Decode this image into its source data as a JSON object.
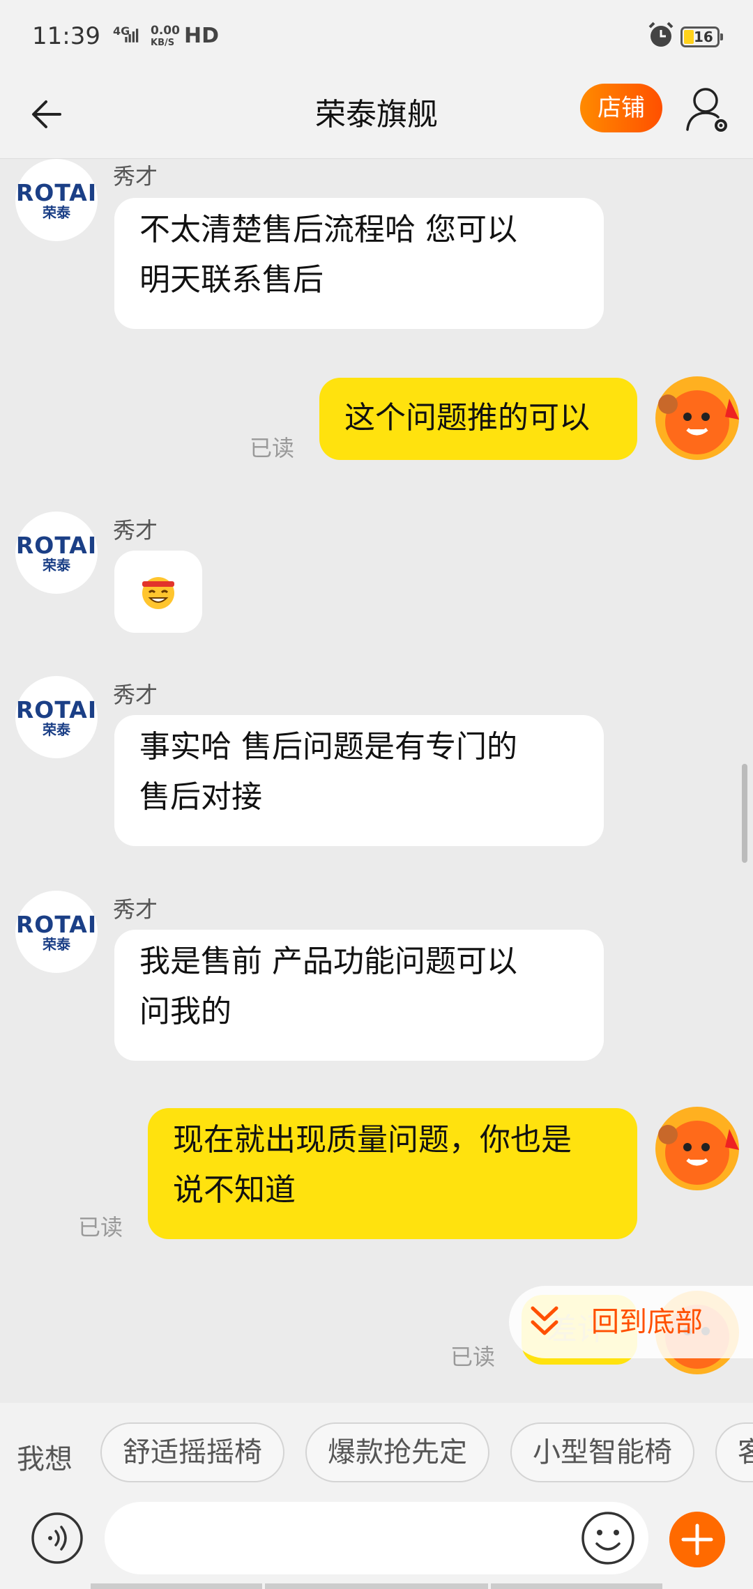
{
  "status_bar": {
    "time": "11:39",
    "network": "4G",
    "speed_top": "0.00",
    "speed_bottom": "KB/S",
    "hd": "HD",
    "battery": "16"
  },
  "header": {
    "title": "荣泰旗舰",
    "shop_button": "店铺"
  },
  "shop_avatar": {
    "brand": "ROTAI",
    "brand_cn": "荣泰"
  },
  "messages": [
    {
      "side": "left",
      "sender": "秀才",
      "lines": [
        "不太清楚售后流程哈 您可以",
        "明天联系售后"
      ]
    },
    {
      "side": "right",
      "lines": [
        "这个问题推的可以"
      ],
      "read": "已读"
    },
    {
      "side": "left",
      "sender": "秀才",
      "emoji": "grinning-headband-emoji"
    },
    {
      "side": "left",
      "sender": "秀才",
      "lines": [
        "事实哈 售后问题是有专门的",
        "售后对接"
      ]
    },
    {
      "side": "left",
      "sender": "秀才",
      "lines": [
        "我是售前 产品功能问题可以",
        "问我的"
      ]
    },
    {
      "side": "right",
      "lines": [
        "现在就出现质量问题，你也是",
        "说不知道"
      ],
      "read": "已读"
    },
    {
      "side": "right",
      "lines": [
        "差评"
      ],
      "read": "已读"
    }
  ],
  "back_to_bottom": "回到底部",
  "quick_phrases": {
    "prefix": "我想",
    "chips": [
      "舒适摇摇椅",
      "爆款抢先定",
      "小型智能椅",
      "客"
    ]
  },
  "icons": {
    "back": "back-arrow-icon",
    "user_settings": "user-settings-icon",
    "voice": "voice-icon",
    "emoji": "smiley-icon",
    "plus": "plus-icon"
  },
  "colors": {
    "accent": "#ff6a00",
    "my_bubble": "#ffe20e",
    "brand": "#1b3f86"
  }
}
